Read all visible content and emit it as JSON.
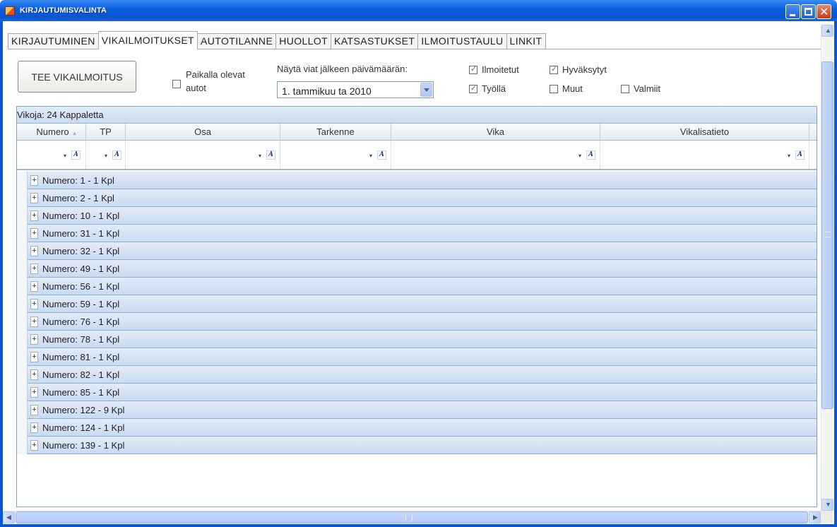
{
  "window": {
    "title": "KIRJAUTUMISVALINTA"
  },
  "tabs": [
    {
      "label": "KIRJAUTUMINEN",
      "active": false
    },
    {
      "label": "VIKAILMOITUKSET",
      "active": true
    },
    {
      "label": "AUTOTILANNE",
      "active": false
    },
    {
      "label": "HUOLLOT",
      "active": false
    },
    {
      "label": "KATSASTUKSET",
      "active": false
    },
    {
      "label": "ILMOITUSTAULU",
      "active": false
    },
    {
      "label": "LINKIT",
      "active": false
    }
  ],
  "toolbar": {
    "new_report_button": "TEE VIKAILMOITUS",
    "on_site_cars": {
      "label_line1": "Paikalla olevat",
      "label_line2": "autot",
      "checked": false
    },
    "date_filter": {
      "label": "Näytä viat jälkeen päivämäärän:",
      "value": "1.  tammikuu ta 2010"
    },
    "status_filters": [
      {
        "label": "Ilmoitetut",
        "checked": true
      },
      {
        "label": "Hyväksytyt",
        "checked": true
      },
      {
        "label": "Työllä",
        "checked": true
      },
      {
        "label": "Muut",
        "checked": false
      },
      {
        "label": "Valmiit",
        "checked": false
      }
    ]
  },
  "grid": {
    "caption": "Vikoja: 24 Kappaletta",
    "columns": [
      "Numero",
      "TP",
      "Osa",
      "Tarkenne",
      "Vika",
      "Vikalisatieto"
    ],
    "groups": [
      "Numero: 1 - 1 Kpl",
      "Numero: 2 - 1 Kpl",
      "Numero: 10 - 1 Kpl",
      "Numero: 31 - 1 Kpl",
      "Numero: 32 - 1 Kpl",
      "Numero: 49 - 1 Kpl",
      "Numero: 56 - 1 Kpl",
      "Numero: 59 - 1 Kpl",
      "Numero: 76 - 1 Kpl",
      "Numero: 78 - 1 Kpl",
      "Numero: 81 - 1 Kpl",
      "Numero: 82 - 1 Kpl",
      "Numero: 85 - 1 Kpl",
      "Numero: 122 - 9 Kpl",
      "Numero: 124 - 1 Kpl",
      "Numero: 139 - 1 Kpl"
    ]
  }
}
